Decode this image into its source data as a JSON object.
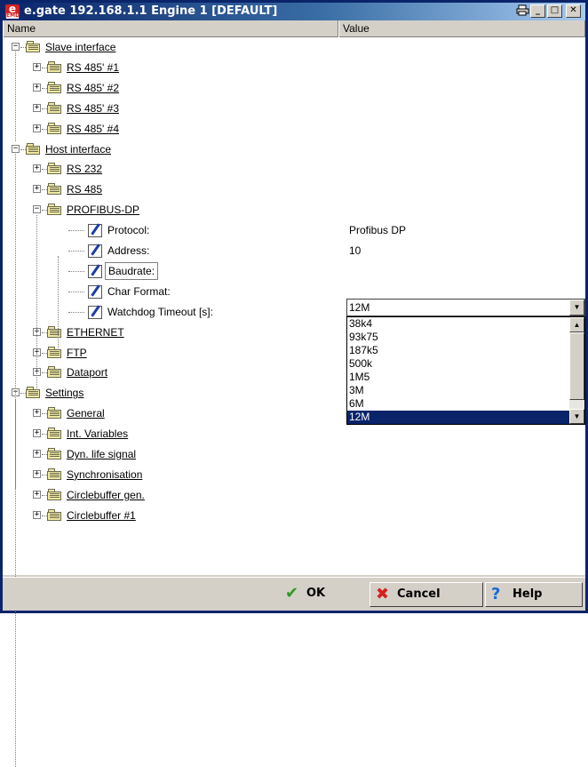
{
  "window": {
    "title": "e.gate 192.168.1.1 Engine 1 [DEFAULT]",
    "icon_text": "e",
    "icon_subtext": "EMD",
    "buttons": [
      "print-icon",
      "minimize",
      "maximize",
      "close"
    ]
  },
  "columns": {
    "name": "Name",
    "value": "Value"
  },
  "tree": [
    {
      "label": "Slave interface",
      "level": 0
    },
    {
      "label": "RS 485' #1",
      "level": 1
    },
    {
      "label": "RS 485' #2",
      "level": 1
    },
    {
      "label": "RS 485' #3",
      "level": 1
    },
    {
      "label": "RS 485' #4",
      "level": 1
    },
    {
      "label": "Host interface",
      "level": 0
    },
    {
      "label": "RS 232",
      "level": 1
    },
    {
      "label": "RS 485",
      "level": 1
    },
    {
      "label": "PROFIBUS-DP",
      "level": 1
    },
    {
      "label": "Protocol:",
      "level": 2,
      "value": "Profibus DP"
    },
    {
      "label": "Address:",
      "level": 2,
      "value": "10"
    },
    {
      "label": "Baudrate:",
      "level": 2,
      "value": "12M"
    },
    {
      "label": "Char Format:",
      "level": 2,
      "value": ""
    },
    {
      "label": "Watchdog Timeout [s]:",
      "level": 2,
      "value": ""
    },
    {
      "label": "ETHERNET",
      "level": 1
    },
    {
      "label": "FTP",
      "level": 1
    },
    {
      "label": "Dataport",
      "level": 1
    },
    {
      "label": "Settings",
      "level": 0
    },
    {
      "label": "General",
      "level": 1
    },
    {
      "label": "Int. Variables",
      "level": 1
    },
    {
      "label": "Dyn. life signal",
      "level": 1
    },
    {
      "label": "Synchronisation",
      "level": 1
    },
    {
      "label": "Circlebuffer gen.",
      "level": 1
    },
    {
      "label": "Circlebuffer #1",
      "level": 1
    }
  ],
  "baudrate_combo": {
    "value": "12M",
    "options": [
      "38k4",
      "93k75",
      "187k5",
      "500k",
      "1M5",
      "3M",
      "6M",
      "12M"
    ],
    "selected": "12M"
  },
  "footer": {
    "ok": "OK",
    "cancel": "Cancel",
    "help": "Help"
  }
}
